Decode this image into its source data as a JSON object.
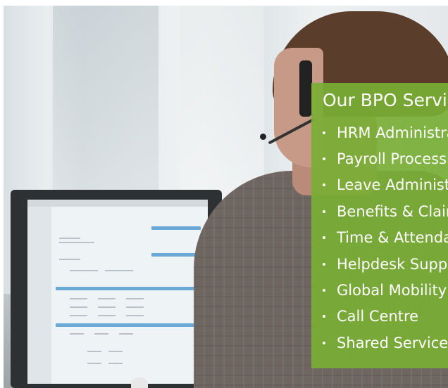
{
  "overlay": {
    "title": "Our BPO Services",
    "accent_color": "#78ae35",
    "services": [
      "HRM Administration",
      "Payroll Processing",
      "Leave Administration",
      "Benefits & Claims",
      "Time & Attendance",
      "Helpdesk Support",
      "Global Mobility",
      "Call Centre",
      "Shared Services"
    ]
  },
  "photo": {
    "subject_icon": "call-centre-agent-photo"
  }
}
